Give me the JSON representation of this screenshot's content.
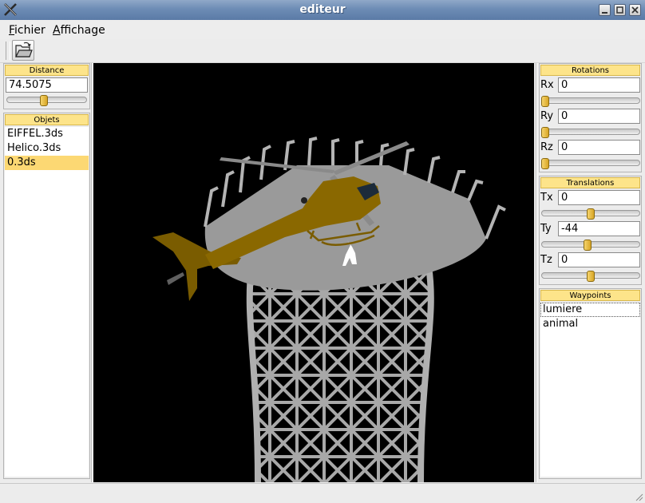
{
  "window": {
    "title": "editeur"
  },
  "menu": {
    "items": [
      {
        "mnemonic": "F",
        "rest": "ichier"
      },
      {
        "mnemonic": "A",
        "rest": "ffichage"
      }
    ]
  },
  "toolbar": {
    "open_icon": "folder-open-icon"
  },
  "distance": {
    "title": "Distance",
    "value": "74.5075",
    "slider_fraction": 0.47
  },
  "objets": {
    "title": "Objets",
    "items": [
      "EIFFEL.3ds",
      "Helico.3ds",
      "0.3ds"
    ],
    "selected": 2
  },
  "rotations": {
    "title": "Rotations",
    "fields": [
      {
        "label": "Rx",
        "value": "0",
        "slider_fraction": 0.0
      },
      {
        "label": "Ry",
        "value": "0",
        "slider_fraction": 0.0
      },
      {
        "label": "Rz",
        "value": "0",
        "slider_fraction": 0.0
      }
    ]
  },
  "translations": {
    "title": "Translations",
    "fields": [
      {
        "label": "Tx",
        "value": "0",
        "slider_fraction": 0.5
      },
      {
        "label": "Ty",
        "value": "-44",
        "slider_fraction": 0.47
      },
      {
        "label": "Tz",
        "value": "0",
        "slider_fraction": 0.5
      }
    ]
  },
  "waypoints": {
    "title": "Waypoints",
    "items": [
      "lumiere",
      "animal"
    ],
    "focused": 0
  },
  "scene": {
    "description_icon": "3d-viewport",
    "tower_color": "#9a9a9a",
    "helicopter_color": "#7a5c00",
    "background": "#000000"
  }
}
